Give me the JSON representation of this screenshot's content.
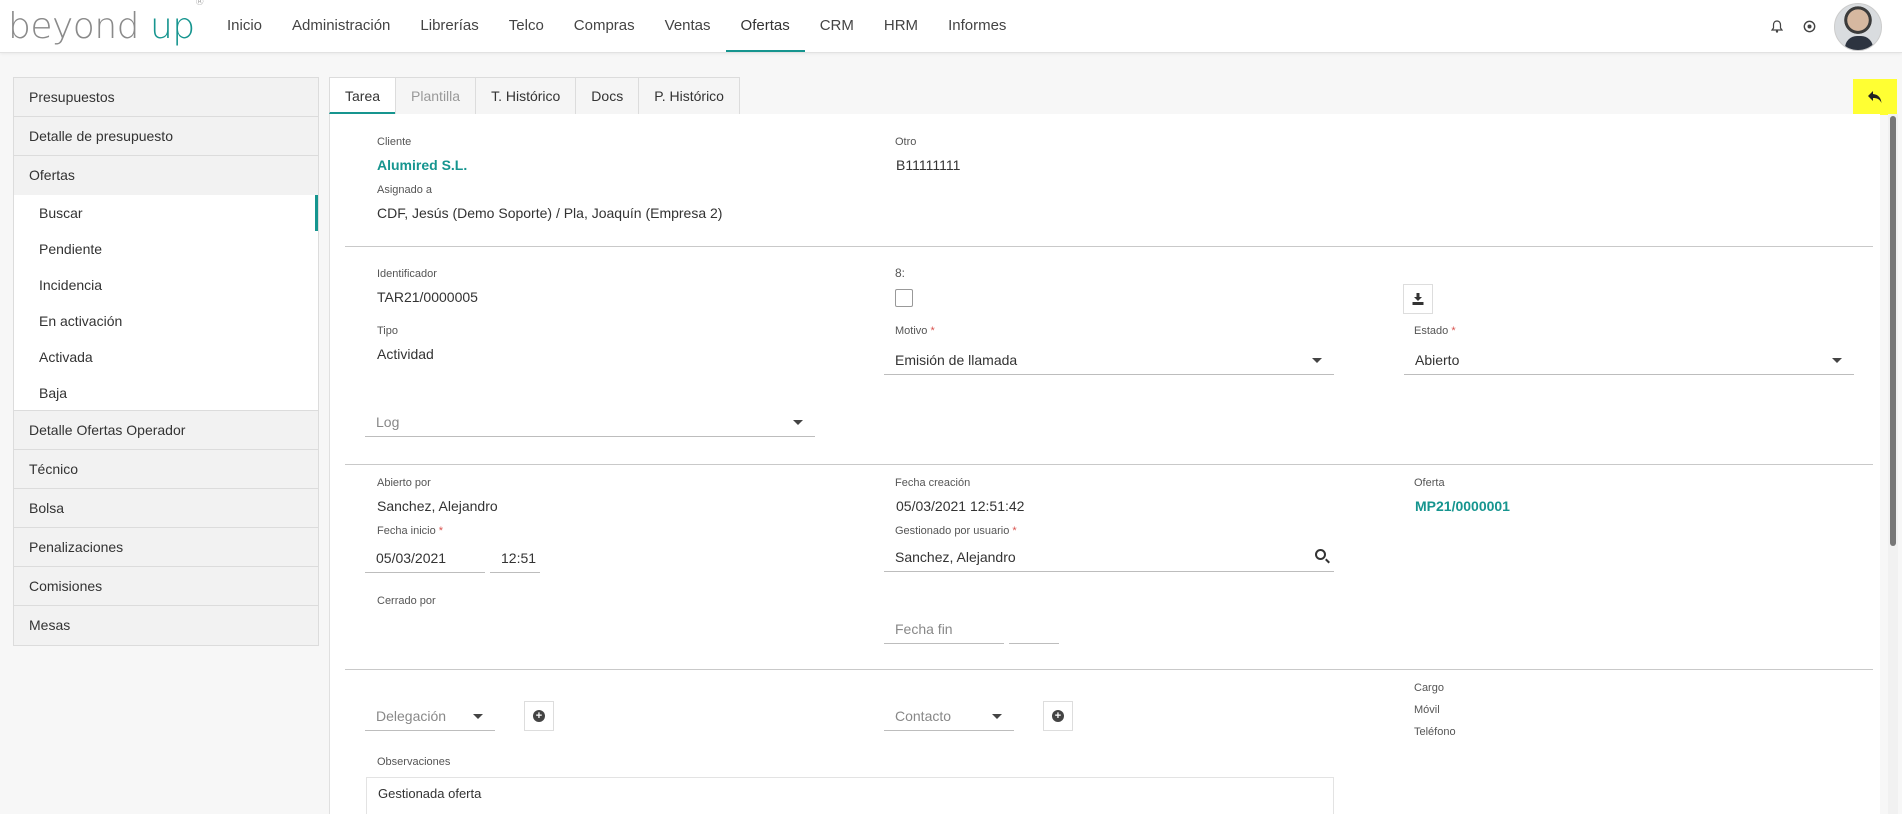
{
  "brand": {
    "word1": "beyond",
    "word2": "up",
    "mark": "®"
  },
  "nav": [
    "Inicio",
    "Administración",
    "Librerías",
    "Telco",
    "Compras",
    "Ventas",
    "Ofertas",
    "CRM",
    "HRM",
    "Informes"
  ],
  "sidebar": {
    "presupuestos": "Presupuestos",
    "detalle_presupuesto": "Detalle de presupuesto",
    "ofertas": "Ofertas",
    "ofertas_items": [
      "Buscar",
      "Pendiente",
      "Incidencia",
      "En activación",
      "Activada",
      "Baja"
    ],
    "detalle_ofertas_operador": "Detalle Ofertas Operador",
    "tecnico": "Técnico",
    "bolsa": "Bolsa",
    "penalizaciones": "Penalizaciones",
    "comisiones": "Comisiones",
    "mesas": "Mesas"
  },
  "tabs": [
    "Tarea",
    "Plantilla",
    "T. Histórico",
    "Docs",
    "P. Histórico"
  ],
  "form": {
    "cliente_label": "Cliente",
    "cliente_value": "Alumired S.L.",
    "otro_label": "Otro",
    "otro_value": "B11111111",
    "asignado_label": "Asignado a",
    "asignado_value": "CDF, Jesús (Demo Soporte) / Pla, Joaquín (Empresa 2)",
    "identificador_label": "Identificador",
    "identificador_value": "TAR21/0000005",
    "s_label": "8:",
    "tipo_label": "Tipo",
    "tipo_value": "Actividad",
    "motivo_label": "Motivo",
    "motivo_value": "Emisión de llamada",
    "estado_label": "Estado",
    "estado_value": "Abierto",
    "required_mark": "*",
    "log_placeholder": "Log",
    "abierto_por_label": "Abierto por",
    "abierto_por_value": "Sanchez, Alejandro",
    "fecha_creacion_label": "Fecha creación",
    "fecha_creacion_value": "05/03/2021 12:51:42",
    "oferta_label": "Oferta",
    "oferta_value": "MP21/0000001",
    "fecha_inicio_label": "Fecha inicio",
    "fecha_inicio_date": "05/03/2021",
    "fecha_inicio_time": "12:51",
    "gestionado_label": "Gestionado por usuario",
    "gestionado_value": "Sanchez, Alejandro",
    "cerrado_por_label": "Cerrado por",
    "fecha_fin_placeholder": "Fecha fin",
    "delegacion_placeholder": "Delegación",
    "contacto_placeholder": "Contacto",
    "cargo_label": "Cargo",
    "movil_label": "Móvil",
    "telefono_label": "Teléfono",
    "observaciones_label": "Observaciones",
    "observaciones_value": "Gestionada oferta"
  },
  "colors": {
    "accent": "#16958f",
    "highlight": "#ffff33",
    "required": "#d9534f"
  },
  "icons": [
    "bell-icon",
    "settings-circle-icon",
    "avatar",
    "reply-icon",
    "download-icon",
    "search-icon",
    "plus-circle-icon",
    "chevron-down-icon"
  ]
}
